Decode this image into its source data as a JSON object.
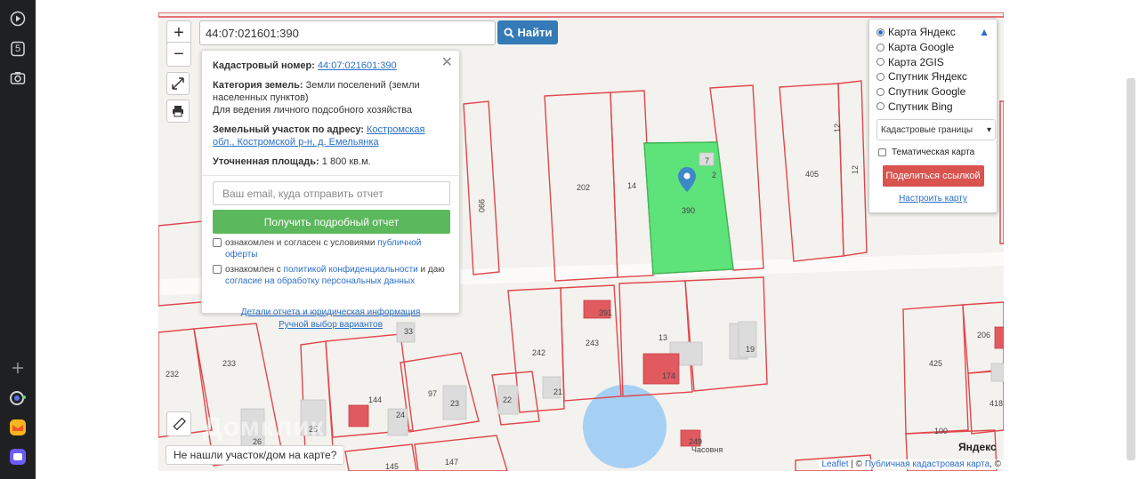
{
  "browser_sidebar": {
    "icons": [
      "play-icon",
      "counter-icon",
      "camera-icon",
      "add-icon",
      "assistant-icon",
      "mail-icon",
      "messenger-icon"
    ],
    "counter_label": "5"
  },
  "search": {
    "value": "44:07:021601:390",
    "button_label": "Найти"
  },
  "map_controls": {
    "zoom_in": "+",
    "zoom_out": "−"
  },
  "popup": {
    "cadastral_label": "Кадастровый номер:",
    "cadastral_value": "44:07:021601:390",
    "category_label": "Категория земель:",
    "category_value": "Земли поселений (земли населенных пунктов)",
    "usage_value": "Для ведения личного подсобного хозяйства",
    "address_label": "Земельный участок по адресу:",
    "address_value": "Костромская обл., Костромской р-н, д. Емельянка",
    "area_label": "Уточненная площадь:",
    "area_value": "1 800 кв.м.",
    "email_placeholder": "Ваш email, куда отправить отчет",
    "report_button": "Получить подробный отчет",
    "consent1_prefix": "ознакомлен и согласен с условиями",
    "consent1_link": "публичной оферты",
    "consent2_prefix": "ознакомлен с",
    "consent2_link1": "политикой конфиденциальности",
    "consent2_mid": "и даю",
    "consent2_link2": "согласие на обработку персональных данных",
    "details_link": "Детали отчета и юридическая информация",
    "manual_link": "Ручной выбор вариантов"
  },
  "layers": {
    "options": [
      {
        "label": "Карта Яндекс",
        "selected": true
      },
      {
        "label": "Карта Google",
        "selected": false
      },
      {
        "label": "Карта 2GIS",
        "selected": false
      },
      {
        "label": "Спутник Яндекс",
        "selected": false
      },
      {
        "label": "Спутник Google",
        "selected": false
      },
      {
        "label": "Спутник Bing",
        "selected": false
      }
    ],
    "select_value": "Кадастровые границы",
    "thematic_label": "Тематическая карта",
    "share_button": "Поделиться ссылкой",
    "setup_link": "Настроить карту"
  },
  "not_found_button": "Не нашли участок/дом на карте?",
  "attribution": {
    "leaflet": "Leaflet",
    "separator": "| ©",
    "cadastral_map": "Публичная кадастровая карта",
    "suffix": ", ©"
  },
  "map_labels": [
    "202",
    "14",
    "2",
    "405",
    "12",
    "12",
    "990",
    "7",
    "390",
    "33",
    "391",
    "242",
    "243",
    "13",
    "174",
    "19",
    "425",
    "206",
    "418",
    "100",
    "232",
    "233",
    "26",
    "25",
    "144",
    "24",
    "97",
    "23",
    "22",
    "21",
    "145",
    "147",
    "249",
    "Часовня"
  ],
  "watermark": "Домклик",
  "yandex_logo": "Яндекс",
  "colors": {
    "parcel_border": "#e0474c",
    "selected_parcel": "#5ee27a",
    "building": "#dcdcdc",
    "building_red": "#e05a5f",
    "pond": "#a5cff3",
    "primary_button": "#337ab7",
    "report_button": "#5cb85c",
    "share_button": "#d9534f"
  }
}
